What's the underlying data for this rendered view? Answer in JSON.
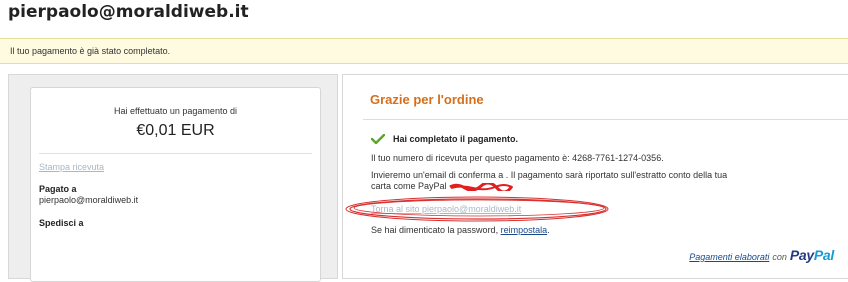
{
  "merchant_email": "pierpaolo@moraldiweb.it",
  "notice": "Il tuo pagamento è già stato completato.",
  "receipt_card": {
    "paid_label": "Hai effettuato un pagamento di",
    "amount": "€0,01 EUR",
    "print_link": "Stampa ricevuta",
    "paid_to_label": "Pagato a",
    "paid_to_value": "pierpaolo@moraldiweb.it",
    "ship_to_label": "Spedisci a"
  },
  "confirmation": {
    "title": "Grazie per l'ordine",
    "complete_message": "Hai completato il pagamento.",
    "receipt_number": "Il tuo numero di ricevuta per questo pagamento è: 4268-7761-1274-0356.",
    "email_line1": "Invieremo un'email di conferma a . Il pagamento sarà riportato sull'estratto conto della tua",
    "email_line2": "carta come PayPal",
    "return_link": "Torna al sito  pierpaolo@moraldiweb.it",
    "forgot_prefix": "Se hai dimenticato la password, ",
    "reset_link": "reimpostala",
    "forgot_suffix": "."
  },
  "footer": {
    "powered_link": "Pagamenti elaborati",
    "powered_with": "con",
    "logo_part1": "Pay",
    "logo_part2": "Pal"
  },
  "colors": {
    "title_orange": "#d56f1b",
    "notice_bg": "#fefbe1",
    "link_blue": "#1a4a8a",
    "scribble_red": "#e02020",
    "check_green": "#5aa52a"
  },
  "icons": [
    "check-icon",
    "paypal-logo"
  ]
}
